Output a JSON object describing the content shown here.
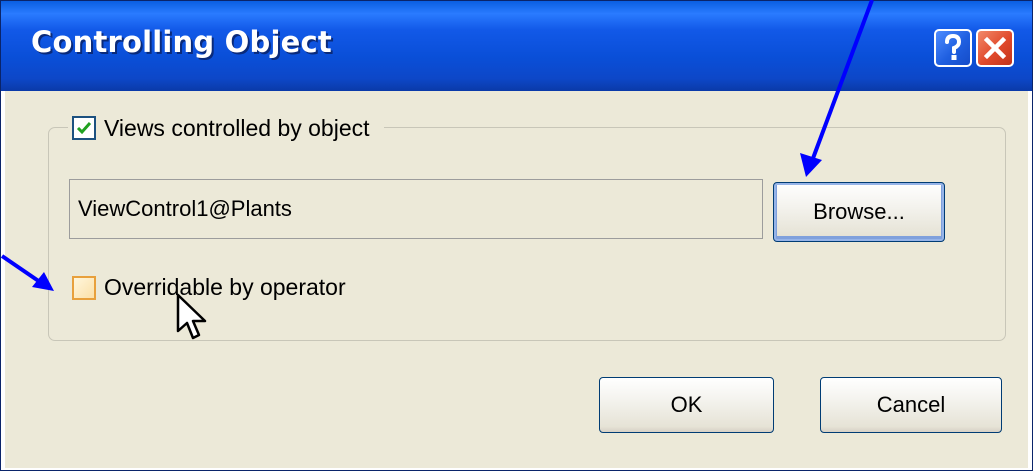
{
  "window": {
    "title": "Controlling Object",
    "help_icon": "question-mark-icon",
    "close_icon": "close-x-icon"
  },
  "views_controlled": {
    "label": "Views controlled by object",
    "checked": true
  },
  "controller_field": {
    "value": "ViewControl1@Plants"
  },
  "browse_button": {
    "label": "Browse..."
  },
  "overridable": {
    "label": "Overridable by operator",
    "checked": false
  },
  "buttons": {
    "ok_label": "OK",
    "cancel_label": "Cancel"
  },
  "colors": {
    "title_bar": "#0a4fd8",
    "dialog_bg": "#ece9d8",
    "annotation_arrow": "#0000ff",
    "close_button": "#e0492b",
    "check_mark": "#21a121"
  }
}
